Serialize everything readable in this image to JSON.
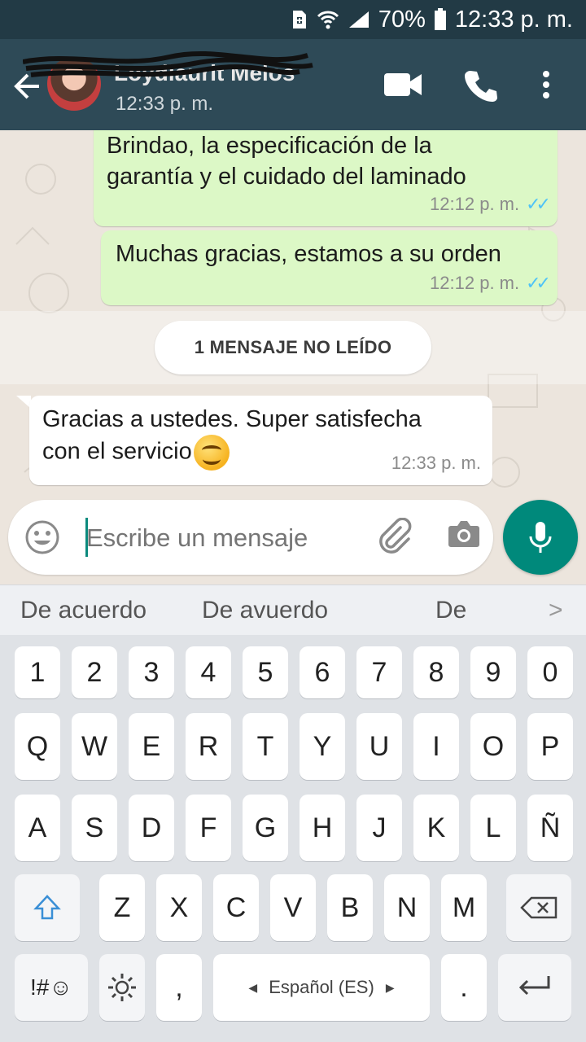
{
  "status_bar": {
    "battery": "70%",
    "time": "12:33 p. m."
  },
  "header": {
    "contact_name": "Loydlaurit Melos",
    "last_seen": "12:33 p. m."
  },
  "messages": [
    {
      "direction": "out",
      "text_line1": "Brindao, la especificación de la",
      "text_line2": "garantía y el cuidado del laminado",
      "time": "12:12 p. m.",
      "ticks": "✓✓"
    },
    {
      "direction": "out",
      "text": "Muchas gracias, estamos a su orden",
      "time": "12:12 p. m.",
      "ticks": "✓✓"
    },
    {
      "direction": "in",
      "text_line1": "Gracias a ustedes. Super satisfecha",
      "text_line2": "con el servicio",
      "emoji": "smiling-face",
      "time": "12:33 p. m."
    }
  ],
  "unread_banner": "1 MENSAJE NO LEÍDO",
  "composer": {
    "placeholder": "Escribe un mensaje"
  },
  "suggestions": [
    "De acuerdo",
    "De avuerdo",
    "De"
  ],
  "keyboard": {
    "row_numbers": [
      "1",
      "2",
      "3",
      "4",
      "5",
      "6",
      "7",
      "8",
      "9",
      "0"
    ],
    "row1": [
      "Q",
      "W",
      "E",
      "R",
      "T",
      "Y",
      "U",
      "I",
      "O",
      "P"
    ],
    "row2": [
      "A",
      "S",
      "D",
      "F",
      "G",
      "H",
      "J",
      "K",
      "L",
      "Ñ"
    ],
    "row3": [
      "Z",
      "X",
      "C",
      "V",
      "B",
      "N",
      "M"
    ],
    "symbols_key": "!#☺",
    "comma": ",",
    "space_label": "Español (ES)",
    "period": "."
  },
  "colors": {
    "status_bar": "#223a45",
    "app_bar": "#2e4a57",
    "outgoing_bubble": "#dcf8c6",
    "incoming_bubble": "#ffffff",
    "accent": "#00897b",
    "read_ticks": "#4fc3f7"
  }
}
